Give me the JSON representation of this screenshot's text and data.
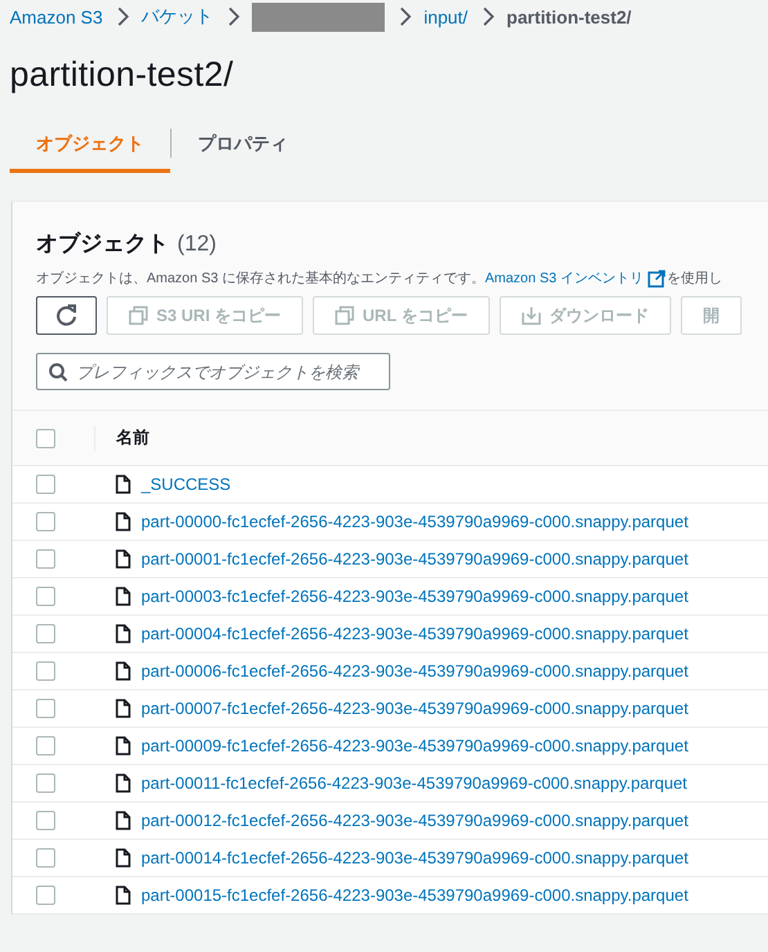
{
  "breadcrumb": [
    {
      "label": "Amazon S3",
      "kind": "link"
    },
    {
      "label": "バケット",
      "kind": "link"
    },
    {
      "kind": "redacted"
    },
    {
      "label": "input/",
      "kind": "link"
    },
    {
      "label": "partition-test2/",
      "kind": "current"
    }
  ],
  "title": "partition-test2/",
  "tabs": [
    {
      "label": "オブジェクト",
      "selected": true
    },
    {
      "label": "プロパティ",
      "selected": false
    }
  ],
  "objects_panel": {
    "heading": "オブジェクト",
    "count": "(12)",
    "description": "オブジェクトは、Amazon S3 に保存された基本的なエンティティです。",
    "description_link": "Amazon S3 インベントリ",
    "description_tail": "を使用し",
    "buttons": [
      {
        "kind": "refresh",
        "disabled": false
      },
      {
        "kind": "copy",
        "label": "S3 URI をコピー",
        "disabled": true
      },
      {
        "kind": "copy",
        "label": "URL をコピー",
        "disabled": true
      },
      {
        "kind": "download",
        "label": "ダウンロード",
        "disabled": true
      },
      {
        "kind": "plain",
        "label": "開",
        "disabled": true
      }
    ],
    "search": {
      "placeholder": "プレフィックスでオブジェクトを検索"
    },
    "table": {
      "columns": [
        "名前"
      ],
      "select_all": {
        "checked": false
      },
      "rows": [
        {
          "name": "_SUCCESS",
          "checked": false
        },
        {
          "name": "part-00000-fc1ecfef-2656-4223-903e-4539790a9969-c000.snappy.parquet",
          "checked": false
        },
        {
          "name": "part-00001-fc1ecfef-2656-4223-903e-4539790a9969-c000.snappy.parquet",
          "checked": false
        },
        {
          "name": "part-00003-fc1ecfef-2656-4223-903e-4539790a9969-c000.snappy.parquet",
          "checked": false
        },
        {
          "name": "part-00004-fc1ecfef-2656-4223-903e-4539790a9969-c000.snappy.parquet",
          "checked": false
        },
        {
          "name": "part-00006-fc1ecfef-2656-4223-903e-4539790a9969-c000.snappy.parquet",
          "checked": false
        },
        {
          "name": "part-00007-fc1ecfef-2656-4223-903e-4539790a9969-c000.snappy.parquet",
          "checked": false
        },
        {
          "name": "part-00009-fc1ecfef-2656-4223-903e-4539790a9969-c000.snappy.parquet",
          "checked": false
        },
        {
          "name": "part-00011-fc1ecfef-2656-4223-903e-4539790a9969-c000.snappy.parquet",
          "checked": false
        },
        {
          "name": "part-00012-fc1ecfef-2656-4223-903e-4539790a9969-c000.snappy.parquet",
          "checked": false
        },
        {
          "name": "part-00014-fc1ecfef-2656-4223-903e-4539790a9969-c000.snappy.parquet",
          "checked": false
        },
        {
          "name": "part-00015-fc1ecfef-2656-4223-903e-4539790a9969-c000.snappy.parquet",
          "checked": false
        }
      ]
    }
  }
}
